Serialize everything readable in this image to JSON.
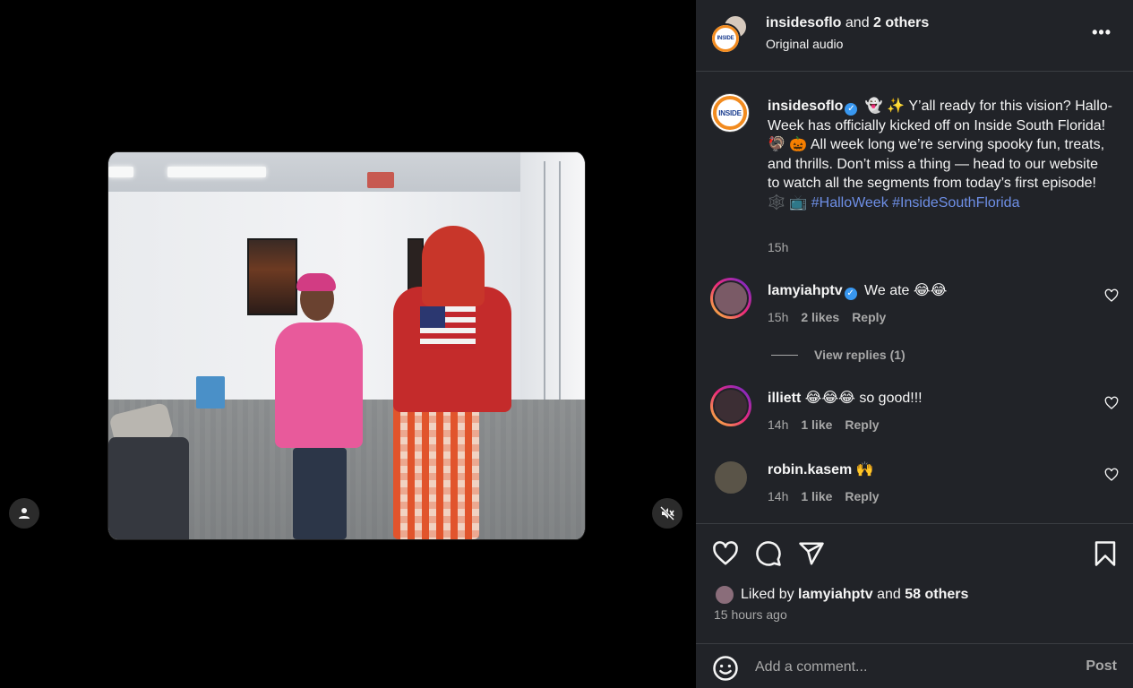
{
  "header": {
    "username": "insidesoflo",
    "others_text": " and ",
    "others_count": "2 others",
    "audio": "Original audio",
    "more": "•••"
  },
  "caption": {
    "username": "insidesoflo",
    "verified_icon": "✓",
    "text": " 👻 ✨ Y’all ready for this vision? Hallo-Week has officially kicked off on Inside South Florida! 🦃 🎃 All week long we’re serving spooky fun, treats, and thrills. Don’t miss a thing — head to our website to watch all the segments from today’s first episode! 🕸️ 📺 ",
    "hashtag1": "#HalloWeek",
    "hashtag2": "#InsideSouthFlorida",
    "time": "15h"
  },
  "logo_text": "INSIDE",
  "comments": [
    {
      "username": "lamyiahptv",
      "verified": "✓",
      "text": " We ate 😂😂",
      "time": "15h",
      "likes": "2 likes",
      "reply": "Reply"
    },
    {
      "username": "illiett",
      "text": " 😂😂😂 so good!!!",
      "time": "14h",
      "likes": "1 like",
      "reply": "Reply"
    },
    {
      "username": "robin.kasem",
      "text": " 🙌",
      "time": "14h",
      "likes": "1 like",
      "reply": "Reply"
    }
  ],
  "view_replies": "View replies (1)",
  "likes": {
    "prefix": "Liked by ",
    "user": "lamyiahptv",
    "mid": " and ",
    "others": "58 others"
  },
  "post_time": "15 hours ago",
  "add_comment": {
    "placeholder": "Add a comment...",
    "post_label": "Post"
  },
  "icons": {
    "user": "user-icon",
    "mute": "mute-icon",
    "heart": "heart-icon",
    "comment": "comment-icon",
    "share": "share-icon",
    "save": "bookmark-icon",
    "emoji": "emoji-icon"
  }
}
